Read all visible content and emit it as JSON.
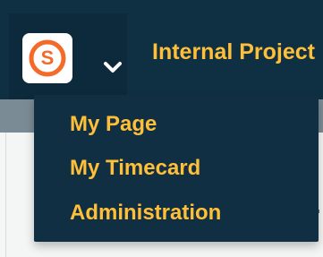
{
  "app": {
    "brand_icon": "s-logo-icon",
    "accent": "#ffbf38",
    "header_background": "#0f3043",
    "menu_toggle_icon": "chevron-down-icon"
  },
  "header": {
    "title": "Internal Project"
  },
  "dropdown": {
    "items": [
      {
        "label": "My Page"
      },
      {
        "label": "My Timecard"
      },
      {
        "label": "Administration"
      }
    ]
  }
}
